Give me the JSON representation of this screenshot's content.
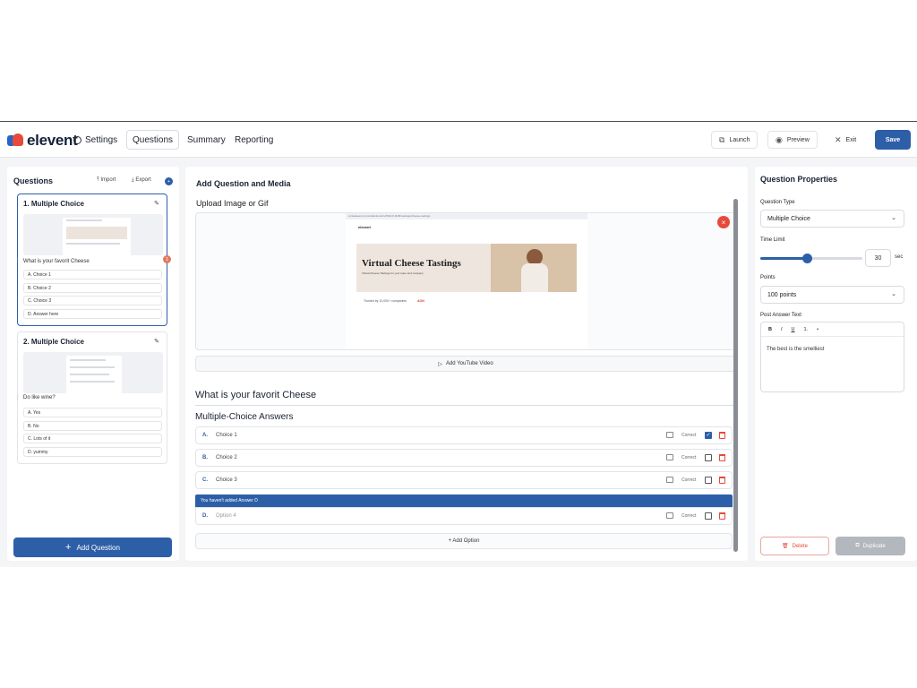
{
  "brand": {
    "name": "elevent"
  },
  "nav": {
    "settings": "Settings",
    "questions": "Questions",
    "summary": "Summary",
    "reporting": "Reporting",
    "launch": "Launch",
    "preview": "Preview",
    "exit": "Exit",
    "save": "Save"
  },
  "left": {
    "title": "Questions",
    "import": "Import",
    "export": "Export",
    "add_question": "Add Question",
    "questions": [
      {
        "header": "1. Multiple Choice",
        "text": "What is your favorit Cheese",
        "badge": "1",
        "options": [
          "A. Choice 1",
          "B. Choice 2",
          "C. Choice 3",
          "D. Answer here"
        ]
      },
      {
        "header": "2. Multiple Choice",
        "text": "Do like wine?",
        "options": [
          "A. Yes",
          "B. No",
          "C. Lots of it",
          "D. yummy"
        ]
      }
    ]
  },
  "center": {
    "title": "Add Question and Media",
    "upload_label": "Upload Image or Gif",
    "media": {
      "url": "ui.itselevent.com/collections/cvz5hld-8-f4c8f-tastings/cheese-tastings",
      "brand": "elevent",
      "hero_title": "Virtual Cheese Tastings",
      "hero_sub": "Virtual Cheese Tastings for your team and company",
      "logo_row": [
        "Trusted by 10,000+ companies",
        "AON"
      ]
    },
    "close_label": "×",
    "youtube": "Add YouTube Video",
    "question_title": "What is your favorit Cheese",
    "answers_title": "Multiple-Choice Answers",
    "correct_label": "Correct",
    "answers": [
      {
        "letter": "A.",
        "text": "Choice 1",
        "correct": true
      },
      {
        "letter": "B.",
        "text": "Choice 2",
        "correct": false
      },
      {
        "letter": "C.",
        "text": "Choice 3",
        "correct": false
      }
    ],
    "warning": "You haven't added Answer D",
    "answer_d": {
      "letter": "D.",
      "placeholder": "Option 4"
    },
    "add_option": "+ Add Option"
  },
  "right": {
    "title": "Question Properties",
    "question_type_label": "Question Type",
    "question_type": "Multiple Choice",
    "time_limit_label": "Time Limit",
    "time_limit_value": "30",
    "time_limit_unit": "sec",
    "slider_fraction": 0.46,
    "points_label": "Points",
    "points": "100 points",
    "post_answer_label": "Post Answer Text",
    "toolbar": [
      "B",
      "I",
      "U",
      "1.",
      "•"
    ],
    "post_answer_text": "The best is the smelliest",
    "delete": "Delete",
    "duplicate": "Duplicate"
  },
  "colors": {
    "primary": "#2d5fa8",
    "danger": "#e64a3b",
    "disabled": "#b3b7be"
  }
}
